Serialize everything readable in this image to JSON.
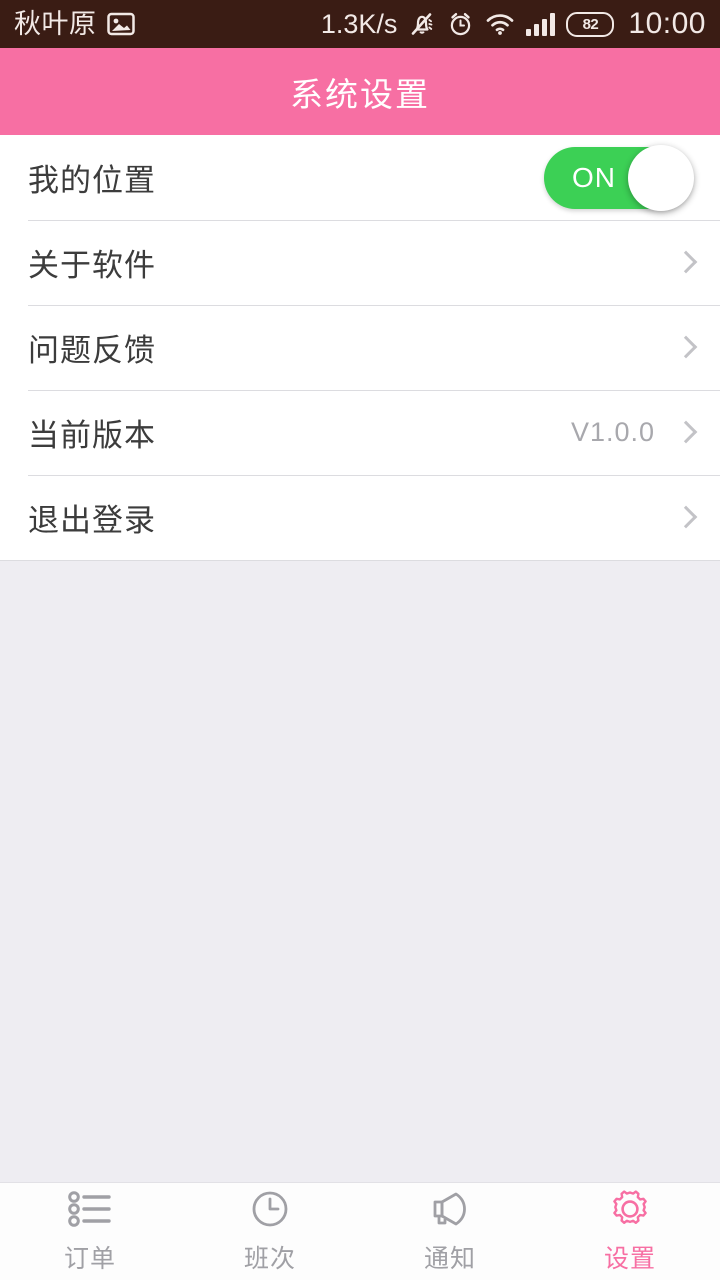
{
  "statusbar": {
    "carrier": "秋叶原",
    "gallery_icon": "image-icon",
    "network_speed": "1.3K/s",
    "mute_icon": "bell-muted-icon",
    "alarm_icon": "alarm-clock-icon",
    "wifi_icon": "wifi-icon",
    "signal_icon": "signal-bars-icon",
    "battery_icon": "battery-icon",
    "battery_level": "82",
    "clock": "10:00",
    "bg_color": "#3A1C14",
    "fg_color": "#F2E9E6"
  },
  "header": {
    "title": "系统设置",
    "bg_color": "#F76FA3",
    "text_color": "#FFFFFF"
  },
  "settings": {
    "rows": [
      {
        "label": "我的位置",
        "type": "toggle",
        "toggle_state": "ON",
        "toggle_on_color": "#3CD055"
      },
      {
        "label": "关于软件",
        "type": "link"
      },
      {
        "label": "问题反馈",
        "type": "link"
      },
      {
        "label": "当前版本",
        "type": "link",
        "value": "V1.0.0"
      },
      {
        "label": "退出登录",
        "type": "link"
      }
    ]
  },
  "tabbar": {
    "active_color": "#F76FA3",
    "inactive_color": "#A0A0A5",
    "tabs": [
      {
        "label": "订单",
        "icon": "list-icon",
        "active": false
      },
      {
        "label": "班次",
        "icon": "clock-icon",
        "active": false
      },
      {
        "label": "通知",
        "icon": "megaphone-icon",
        "active": false
      },
      {
        "label": "设置",
        "icon": "gear-icon",
        "active": true
      }
    ]
  }
}
